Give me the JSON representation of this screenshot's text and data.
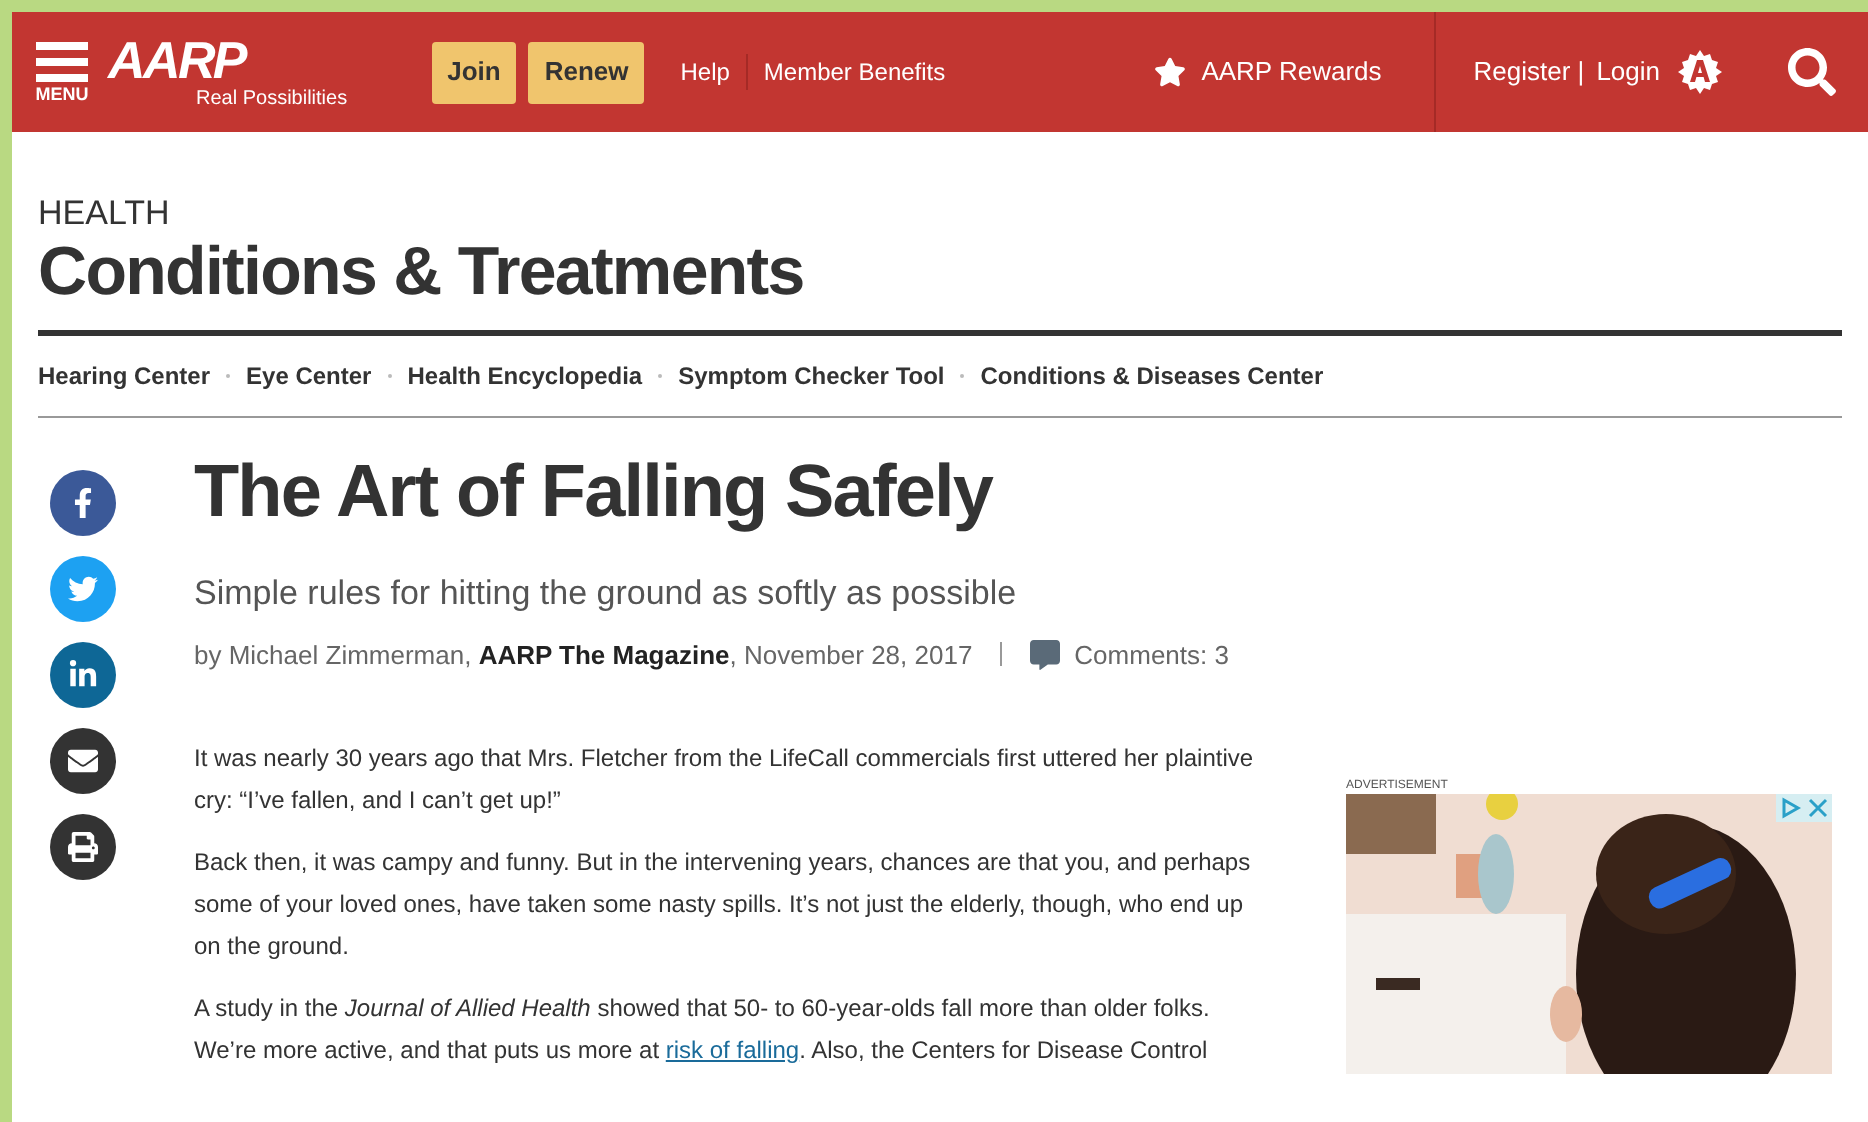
{
  "header": {
    "menu_label": "MENU",
    "logo": "AARP",
    "tagline": "Real Possibilities",
    "buttons": [
      {
        "label": "Join"
      },
      {
        "label": "Renew"
      }
    ],
    "links": [
      {
        "label": "Help"
      },
      {
        "label": "Member Benefits"
      }
    ],
    "rewards": "AARP Rewards",
    "register": "Register |",
    "login": "Login"
  },
  "section": {
    "kicker": "HEALTH",
    "title": "Conditions & Treatments",
    "nav": [
      {
        "label": "Hearing Center"
      },
      {
        "label": "Eye Center"
      },
      {
        "label": "Health Encyclopedia"
      },
      {
        "label": "Symptom Checker Tool"
      },
      {
        "label": "Conditions & Diseases Center"
      }
    ]
  },
  "share": [
    {
      "kind": "facebook",
      "color": "#3b5998"
    },
    {
      "kind": "twitter",
      "color": "#1da1f2"
    },
    {
      "kind": "linkedin",
      "color": "#0e6796"
    },
    {
      "kind": "email",
      "color": "#333333"
    },
    {
      "kind": "print",
      "color": "#333333"
    }
  ],
  "article": {
    "title": "The Art of Falling Safely",
    "subtitle": "Simple rules for hitting the ground as softly as possible",
    "byline": "by Michael Zimmerman, **AARP The Magazine**, November 28, 2017",
    "comments": "Comments: 3",
    "paragraphs": [
      [
        {
          "kind": "text",
          "text": "It was nearly 30 years ago that Mrs. Fletcher from the LifeCall commercials first uttered her plaintive cry: “I’ve fallen, and I can’t get up!”"
        }
      ],
      [
        {
          "kind": "text",
          "text": "Back then, it was campy and funny. But in the intervening years, chances are that you, and perhaps some of your loved ones, have taken some nasty spills. It’s not just the elderly, though, who end up on the ground."
        }
      ],
      [
        {
          "kind": "text",
          "text": "A study in the *Journal of Allied Health* showed that 50- to 60-year-olds fall more than older folks. We’re more active, and that puts us more at "
        },
        {
          "kind": "link",
          "text": "risk of falling"
        },
        {
          "kind": "text",
          "text": ". Also, the Centers for Disease Control"
        }
      ]
    ]
  },
  "ad": {
    "label": "ADVERTISEMENT",
    "kind": "picture"
  }
}
